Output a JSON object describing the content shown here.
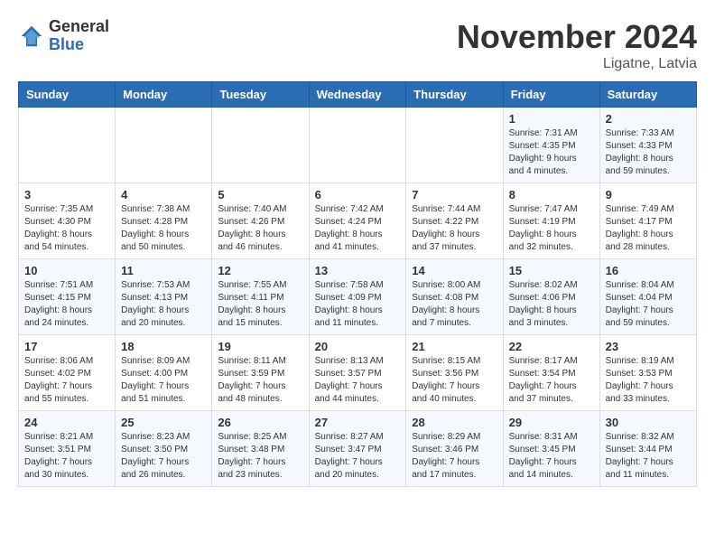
{
  "logo": {
    "general": "General",
    "blue": "Blue"
  },
  "title": "November 2024",
  "location": "Ligatne, Latvia",
  "days_of_week": [
    "Sunday",
    "Monday",
    "Tuesday",
    "Wednesday",
    "Thursday",
    "Friday",
    "Saturday"
  ],
  "weeks": [
    [
      {
        "day": "",
        "info": ""
      },
      {
        "day": "",
        "info": ""
      },
      {
        "day": "",
        "info": ""
      },
      {
        "day": "",
        "info": ""
      },
      {
        "day": "",
        "info": ""
      },
      {
        "day": "1",
        "info": "Sunrise: 7:31 AM\nSunset: 4:35 PM\nDaylight: 9 hours\nand 4 minutes."
      },
      {
        "day": "2",
        "info": "Sunrise: 7:33 AM\nSunset: 4:33 PM\nDaylight: 8 hours\nand 59 minutes."
      }
    ],
    [
      {
        "day": "3",
        "info": "Sunrise: 7:35 AM\nSunset: 4:30 PM\nDaylight: 8 hours\nand 54 minutes."
      },
      {
        "day": "4",
        "info": "Sunrise: 7:38 AM\nSunset: 4:28 PM\nDaylight: 8 hours\nand 50 minutes."
      },
      {
        "day": "5",
        "info": "Sunrise: 7:40 AM\nSunset: 4:26 PM\nDaylight: 8 hours\nand 46 minutes."
      },
      {
        "day": "6",
        "info": "Sunrise: 7:42 AM\nSunset: 4:24 PM\nDaylight: 8 hours\nand 41 minutes."
      },
      {
        "day": "7",
        "info": "Sunrise: 7:44 AM\nSunset: 4:22 PM\nDaylight: 8 hours\nand 37 minutes."
      },
      {
        "day": "8",
        "info": "Sunrise: 7:47 AM\nSunset: 4:19 PM\nDaylight: 8 hours\nand 32 minutes."
      },
      {
        "day": "9",
        "info": "Sunrise: 7:49 AM\nSunset: 4:17 PM\nDaylight: 8 hours\nand 28 minutes."
      }
    ],
    [
      {
        "day": "10",
        "info": "Sunrise: 7:51 AM\nSunset: 4:15 PM\nDaylight: 8 hours\nand 24 minutes."
      },
      {
        "day": "11",
        "info": "Sunrise: 7:53 AM\nSunset: 4:13 PM\nDaylight: 8 hours\nand 20 minutes."
      },
      {
        "day": "12",
        "info": "Sunrise: 7:55 AM\nSunset: 4:11 PM\nDaylight: 8 hours\nand 15 minutes."
      },
      {
        "day": "13",
        "info": "Sunrise: 7:58 AM\nSunset: 4:09 PM\nDaylight: 8 hours\nand 11 minutes."
      },
      {
        "day": "14",
        "info": "Sunrise: 8:00 AM\nSunset: 4:08 PM\nDaylight: 8 hours\nand 7 minutes."
      },
      {
        "day": "15",
        "info": "Sunrise: 8:02 AM\nSunset: 4:06 PM\nDaylight: 8 hours\nand 3 minutes."
      },
      {
        "day": "16",
        "info": "Sunrise: 8:04 AM\nSunset: 4:04 PM\nDaylight: 7 hours\nand 59 minutes."
      }
    ],
    [
      {
        "day": "17",
        "info": "Sunrise: 8:06 AM\nSunset: 4:02 PM\nDaylight: 7 hours\nand 55 minutes."
      },
      {
        "day": "18",
        "info": "Sunrise: 8:09 AM\nSunset: 4:00 PM\nDaylight: 7 hours\nand 51 minutes."
      },
      {
        "day": "19",
        "info": "Sunrise: 8:11 AM\nSunset: 3:59 PM\nDaylight: 7 hours\nand 48 minutes."
      },
      {
        "day": "20",
        "info": "Sunrise: 8:13 AM\nSunset: 3:57 PM\nDaylight: 7 hours\nand 44 minutes."
      },
      {
        "day": "21",
        "info": "Sunrise: 8:15 AM\nSunset: 3:56 PM\nDaylight: 7 hours\nand 40 minutes."
      },
      {
        "day": "22",
        "info": "Sunrise: 8:17 AM\nSunset: 3:54 PM\nDaylight: 7 hours\nand 37 minutes."
      },
      {
        "day": "23",
        "info": "Sunrise: 8:19 AM\nSunset: 3:53 PM\nDaylight: 7 hours\nand 33 minutes."
      }
    ],
    [
      {
        "day": "24",
        "info": "Sunrise: 8:21 AM\nSunset: 3:51 PM\nDaylight: 7 hours\nand 30 minutes."
      },
      {
        "day": "25",
        "info": "Sunrise: 8:23 AM\nSunset: 3:50 PM\nDaylight: 7 hours\nand 26 minutes."
      },
      {
        "day": "26",
        "info": "Sunrise: 8:25 AM\nSunset: 3:48 PM\nDaylight: 7 hours\nand 23 minutes."
      },
      {
        "day": "27",
        "info": "Sunrise: 8:27 AM\nSunset: 3:47 PM\nDaylight: 7 hours\nand 20 minutes."
      },
      {
        "day": "28",
        "info": "Sunrise: 8:29 AM\nSunset: 3:46 PM\nDaylight: 7 hours\nand 17 minutes."
      },
      {
        "day": "29",
        "info": "Sunrise: 8:31 AM\nSunset: 3:45 PM\nDaylight: 7 hours\nand 14 minutes."
      },
      {
        "day": "30",
        "info": "Sunrise: 8:32 AM\nSunset: 3:44 PM\nDaylight: 7 hours\nand 11 minutes."
      }
    ]
  ]
}
